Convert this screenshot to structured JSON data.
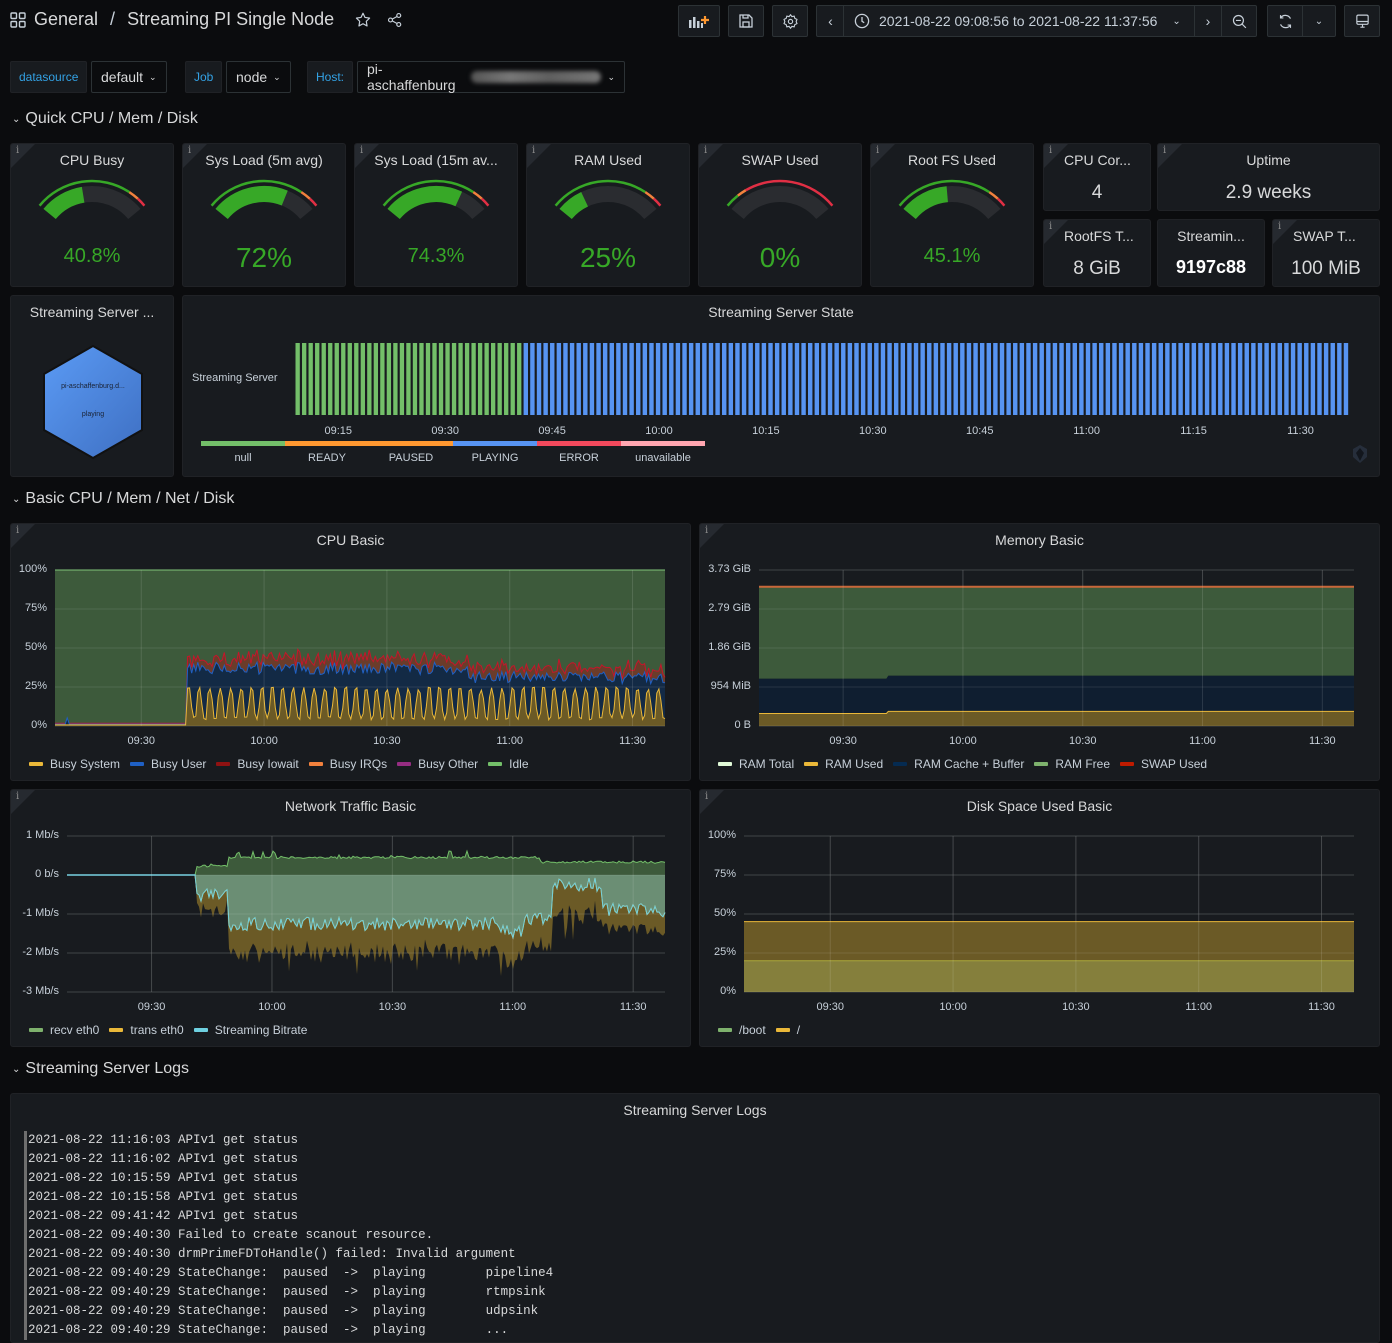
{
  "header": {
    "folder": "General",
    "separator": "/",
    "title": "Streaming PI Single Node",
    "time_range": "2021-08-22 09:08:56 to 2021-08-22 11:37:56"
  },
  "variables": [
    {
      "label": "datasource",
      "value": "default"
    },
    {
      "label": "Job",
      "value": "node"
    },
    {
      "label": "Host:",
      "value": "pi-aschaffenburg"
    }
  ],
  "rows": {
    "quick": "Quick CPU / Mem / Disk",
    "basic": "Basic CPU / Mem / Net / Disk",
    "logs": "Streaming Server Logs"
  },
  "gauges": [
    {
      "title": "CPU Busy",
      "value": "40.8%",
      "fraction": 0.408,
      "thresholds": "green-orange-red"
    },
    {
      "title": "Sys Load (5m avg)",
      "value": "72%",
      "fraction": 0.72,
      "thresholds": "green-orange-red"
    },
    {
      "title": "Sys Load (15m av...",
      "value": "74.3%",
      "fraction": 0.743,
      "thresholds": "green-orange-red"
    },
    {
      "title": "RAM Used",
      "value": "25%",
      "fraction": 0.25,
      "thresholds": "green-orange-red"
    },
    {
      "title": "SWAP Used",
      "value": "0%",
      "fraction": 0.0,
      "thresholds": "red-dominant"
    },
    {
      "title": "Root FS Used",
      "value": "45.1%",
      "fraction": 0.451,
      "thresholds": "green-orange-red"
    }
  ],
  "stats": {
    "cpu_cores": {
      "title": "CPU Cor...",
      "value": "4"
    },
    "uptime": {
      "title": "Uptime",
      "value": "2.9 weeks"
    },
    "rootfs_total": {
      "title": "RootFS T...",
      "value": "8 GiB"
    },
    "streaming_version": {
      "title": "Streamin...",
      "value": "9197c88"
    },
    "swap_total": {
      "title": "SWAP T...",
      "value": "100 MiB"
    }
  },
  "hexagon": {
    "title": "Streaming Server ...",
    "host": "pi-aschaffenburg.d...",
    "state": "playing",
    "color": "#5794f2"
  },
  "state_timeline": {
    "title": "Streaming Server State",
    "row_label": "Streaming Server",
    "x_ticks": [
      "09:15",
      "09:30",
      "09:45",
      "10:00",
      "10:15",
      "10:30",
      "10:45",
      "11:00",
      "11:15",
      "11:30"
    ],
    "segments": [
      {
        "state": "READY",
        "from": "09:09",
        "to": "09:41"
      },
      {
        "state": "PLAYING",
        "from": "09:41",
        "to": "11:37"
      }
    ],
    "legend": [
      {
        "label": "null",
        "color": "#73bf69"
      },
      {
        "label": "READY",
        "color": "#ff9830"
      },
      {
        "label": "PAUSED",
        "color": "#ff9830"
      },
      {
        "label": "PLAYING",
        "color": "#5794f2"
      },
      {
        "label": "ERROR",
        "color": "#f2495c"
      },
      {
        "label": "unavailable",
        "color": "#ffa6b0"
      }
    ]
  },
  "chart_data": [
    {
      "type": "area",
      "title": "CPU Basic",
      "y_ticks": [
        "100%",
        "75%",
        "50%",
        "25%",
        "0%"
      ],
      "x_ticks": [
        "09:30",
        "10:00",
        "10:30",
        "11:00",
        "11:30"
      ],
      "ylim": [
        0,
        100
      ],
      "series": [
        {
          "name": "Busy System",
          "color": "#eab839",
          "summary": "~1% until 09:41, then oscillating 3-24%"
        },
        {
          "name": "Busy User",
          "color": "#1f60c4",
          "summary": "~1% until 09:41, then ~15-20%"
        },
        {
          "name": "Busy Iowait",
          "color": "#8f1212",
          "summary": "~5% after 09:41"
        },
        {
          "name": "Busy IRQs",
          "color": "#f2813d",
          "summary": "~0%"
        },
        {
          "name": "Busy Other",
          "color": "#962d82",
          "summary": "~0%"
        },
        {
          "name": "Idle",
          "color": "#73bf69",
          "summary": "remainder to 100%"
        }
      ],
      "stack_top_pct": {
        "before_09_41": 2,
        "after_09_41_range": [
          32,
          53
        ]
      }
    },
    {
      "type": "area",
      "title": "Memory Basic",
      "y_ticks": [
        "3.73 GiB",
        "2.79 GiB",
        "1.86 GiB",
        "954 MiB",
        "0 B"
      ],
      "x_ticks": [
        "09:30",
        "10:00",
        "10:30",
        "11:00",
        "11:30"
      ],
      "series": [
        {
          "name": "RAM Total",
          "color": "#e0f9d7",
          "value_gib": 3.33
        },
        {
          "name": "RAM Used",
          "color": "#eab839",
          "value_gib_before": 0.3,
          "value_gib_after": 0.35
        },
        {
          "name": "RAM Cache + Buffer",
          "color": "#052b51",
          "top_gib_before": 1.15,
          "top_gib_after": 1.2
        },
        {
          "name": "RAM Free",
          "color": "#7eb26d",
          "top_gib": 3.33
        },
        {
          "name": "SWAP Used",
          "color": "#bf1b00",
          "value_gib": 0
        }
      ]
    },
    {
      "type": "area",
      "title": "Network Traffic Basic",
      "y_ticks": [
        "1 Mb/s",
        "0 b/s",
        "-1 Mb/s",
        "-2 Mb/s",
        "-3 Mb/s"
      ],
      "x_ticks": [
        "09:30",
        "10:00",
        "10:30",
        "11:00",
        "11:30"
      ],
      "ylim": [
        -3,
        1
      ],
      "series": [
        {
          "name": "recv eth0",
          "color": "#7eb26d",
          "summary": "0 until 09:41, then ~0.2-0.6 Mb/s"
        },
        {
          "name": "trans eth0",
          "color": "#eab839",
          "summary": "0 until 09:41, then -0.7 to -2.3 Mb/s; ~-1.4 at end"
        },
        {
          "name": "Streaming Bitrate",
          "color": "#6ed0e0",
          "summary": "0 until 09:41, then -0.5 to -1.6 Mb/s; ~-0.9 at end"
        }
      ]
    },
    {
      "type": "area",
      "title": "Disk Space Used Basic",
      "y_ticks": [
        "100%",
        "75%",
        "50%",
        "25%",
        "0%"
      ],
      "x_ticks": [
        "09:30",
        "10:00",
        "10:30",
        "11:00",
        "11:30"
      ],
      "ylim": [
        0,
        100
      ],
      "series": [
        {
          "name": "/boot",
          "color": "#7eb26d",
          "value_pct": 20
        },
        {
          "name": "/",
          "color": "#eab839",
          "value_pct": 45.1
        }
      ]
    }
  ],
  "logs": {
    "title": "Streaming Server Logs",
    "lines": [
      "2021-08-22 11:16:03 APIv1 get status",
      "2021-08-22 11:16:02 APIv1 get status",
      "2021-08-22 10:15:59 APIv1 get status",
      "2021-08-22 10:15:58 APIv1 get status",
      "2021-08-22 09:41:42 APIv1 get status",
      "2021-08-22 09:40:30 Failed to create scanout resource.",
      "2021-08-22 09:40:30 drmPrimeFDToHandle() failed: Invalid argument",
      "2021-08-22 09:40:29 StateChange:  paused  ->  playing        pipeline4",
      "2021-08-22 09:40:29 StateChange:  paused  ->  playing        rtmpsink",
      "2021-08-22 09:40:29 StateChange:  paused  ->  playing        udpsink",
      "2021-08-22 09:40:29 StateChange:  paused  ->  playing        ..."
    ]
  }
}
